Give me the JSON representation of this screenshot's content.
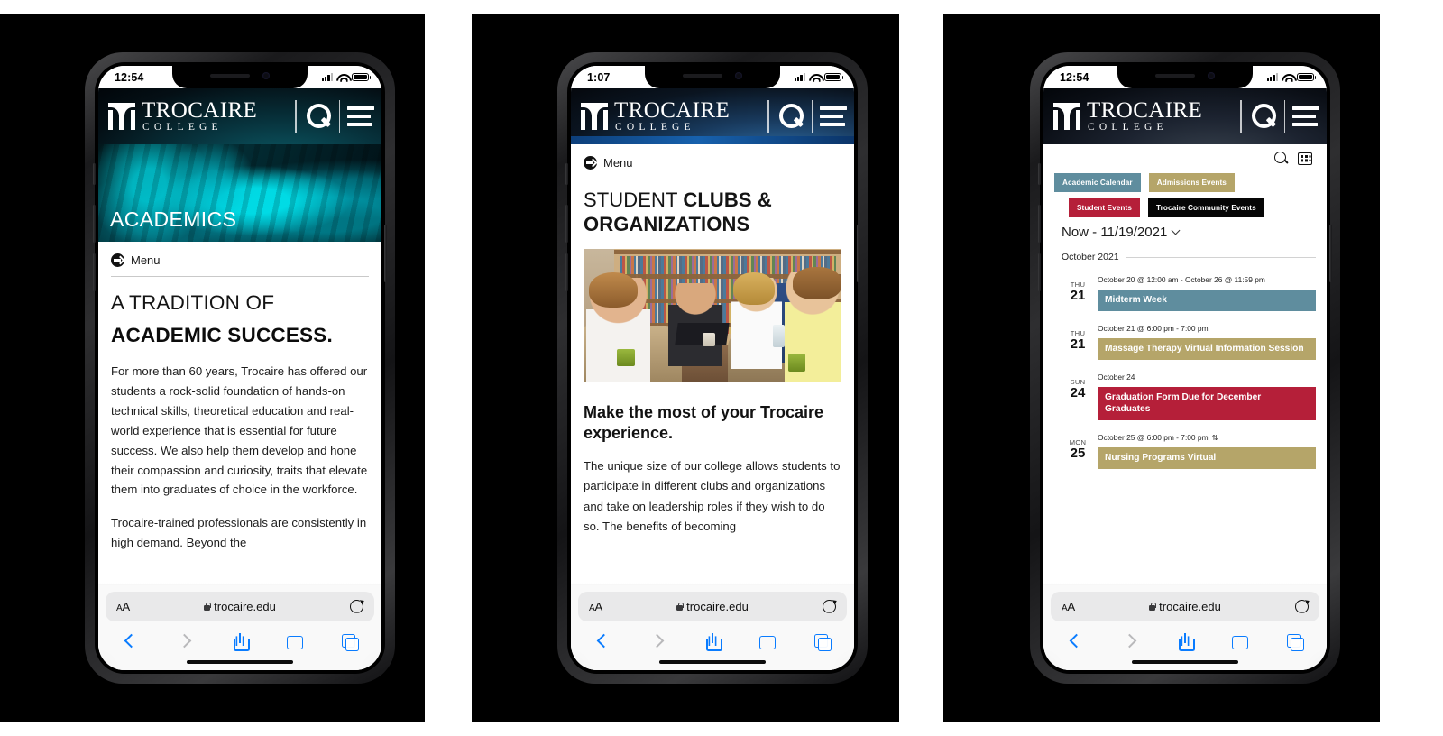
{
  "panels": [
    {
      "id": "panel-1",
      "status": {
        "time": "12:54",
        "signal_icon": "cellular-signal-icon",
        "wifi_icon": "wifi-icon",
        "battery_icon": "battery-icon"
      },
      "header": {
        "logo_main": "TROCAIRE",
        "logo_sub": "COLLEGE",
        "logo_mark_icon": "trocaire-crest-icon",
        "search_icon": "search-icon",
        "menu_icon": "hamburger-menu-icon"
      },
      "hero": {
        "title": "ACADEMICS",
        "image_alt": "surgical-technology-students-photo"
      },
      "menu": {
        "label": "Menu",
        "icon": "arrow-circle-right-icon"
      },
      "heading_light": "A TRADITION OF",
      "heading_bold": "ACADEMIC SUCCESS.",
      "paragraphs": [
        "For more than 60 years, Trocaire has offered our students a rock-solid foundation of hands-on technical skills, theoretical education and real-world experience that is essential for future success. We also help them develop and hone their compassion and curiosity, traits that elevate them into graduates of choice in the workforce.",
        "Trocaire-trained professionals are consistently in high demand. Beyond the"
      ],
      "safari": {
        "text_size_label": "AA",
        "lock_icon": "lock-icon",
        "url": "trocaire.edu",
        "reload_icon": "reload-icon",
        "back_icon": "chevron-left-icon",
        "forward_icon": "chevron-right-icon",
        "share_icon": "share-icon",
        "bookmarks_icon": "book-icon",
        "tabs_icon": "tabs-icon"
      }
    },
    {
      "id": "panel-2",
      "status": {
        "time": "1:07",
        "signal_icon": "cellular-signal-icon",
        "wifi_icon": "wifi-icon",
        "battery_icon": "battery-icon"
      },
      "header": {
        "logo_main": "TROCAIRE",
        "logo_sub": "COLLEGE",
        "logo_mark_icon": "trocaire-crest-icon",
        "search_icon": "search-icon",
        "menu_icon": "hamburger-menu-icon"
      },
      "menu": {
        "label": "Menu",
        "icon": "arrow-circle-right-icon"
      },
      "title_light": "STUDENT ",
      "title_bold_1": "CLUBS &",
      "title_bold_2": "ORGANIZATIONS",
      "photo_alt": "students-in-library-lounge-photo",
      "heading_bold": "Make the most of your Trocaire experience.",
      "paragraph": "The unique size of our college allows students to participate in different clubs and organizations and take on leadership roles if they wish to do so. The benefits of becoming",
      "safari": {
        "text_size_label": "AA",
        "lock_icon": "lock-icon",
        "url": "trocaire.edu",
        "reload_icon": "reload-icon",
        "back_icon": "chevron-left-icon",
        "forward_icon": "chevron-right-icon",
        "share_icon": "share-icon",
        "bookmarks_icon": "book-icon",
        "tabs_icon": "tabs-icon"
      }
    },
    {
      "id": "panel-3",
      "status": {
        "time": "12:54",
        "signal_icon": "cellular-signal-icon",
        "wifi_icon": "wifi-icon",
        "battery_icon": "battery-icon"
      },
      "header": {
        "logo_main": "TROCAIRE",
        "logo_sub": "COLLEGE",
        "logo_mark_icon": "trocaire-crest-icon",
        "search_icon": "search-icon",
        "menu_icon": "hamburger-menu-icon"
      },
      "calendar": {
        "search_icon": "search-icon",
        "view_icon": "list-view-icon",
        "filters": [
          {
            "label": "Academic Calendar",
            "color": "#5f8d9e",
            "style": "teal"
          },
          {
            "label": "Admissions Events",
            "color": "#b5a569",
            "style": "khaki"
          },
          {
            "label": "Student Events",
            "color": "#b51f39",
            "style": "crimson"
          },
          {
            "label": "Trocaire Community Events",
            "color": "#060606",
            "style": "black"
          }
        ],
        "range_label": "Now - 11/19/2021",
        "range_caret_icon": "chevron-down-icon",
        "month_label": "October 2021",
        "events": [
          {
            "dow": "THU",
            "day": "21",
            "time": "October 20 @ 12:00 am - October 26 @ 11:59 pm",
            "title": "Midterm Week",
            "color": "#5f8d9e",
            "style": "teal",
            "recurring": false
          },
          {
            "dow": "THU",
            "day": "21",
            "time": "October 21 @ 6:00 pm - 7:00 pm",
            "title": "Massage Therapy Virtual Information Session",
            "color": "#b5a569",
            "style": "khaki",
            "recurring": false
          },
          {
            "dow": "SUN",
            "day": "24",
            "time": "October 24",
            "title": "Graduation Form Due for December Graduates",
            "color": "#b51f39",
            "style": "crimson",
            "recurring": false
          },
          {
            "dow": "MON",
            "day": "25",
            "time": "October 25 @ 6:00 pm - 7:00 pm",
            "title": "Nursing Programs Virtual",
            "color": "#b5a569",
            "style": "khaki",
            "recurring": true,
            "recur_icon": "recurring-event-icon"
          }
        ]
      },
      "safari": {
        "text_size_label": "AA",
        "lock_icon": "lock-icon",
        "url": "trocaire.edu",
        "reload_icon": "reload-icon",
        "back_icon": "chevron-left-icon",
        "forward_icon": "chevron-right-icon",
        "share_icon": "share-icon",
        "bookmarks_icon": "book-icon",
        "tabs_icon": "tabs-icon"
      }
    }
  ]
}
